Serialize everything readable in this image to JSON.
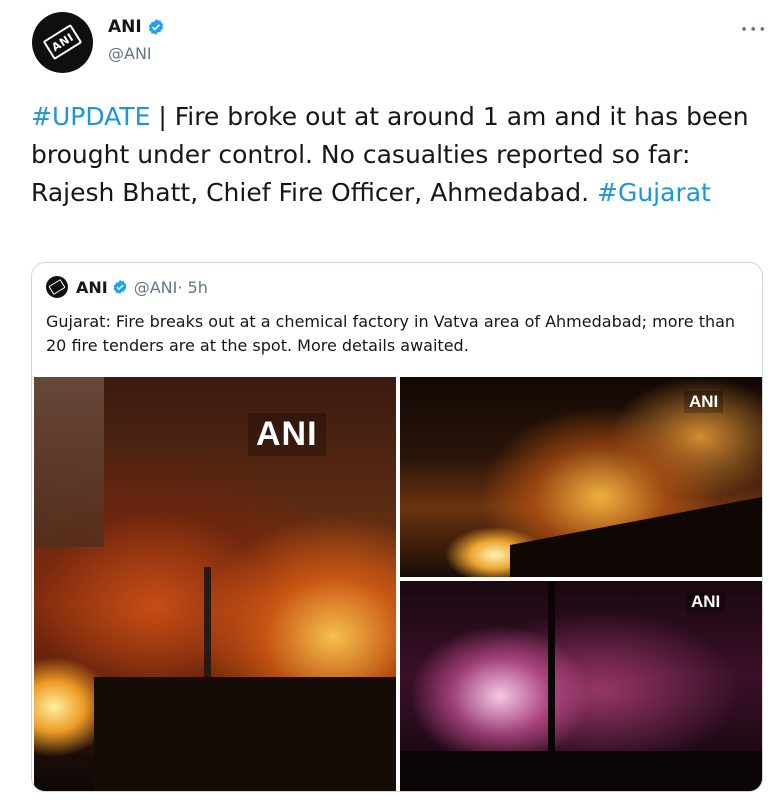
{
  "tweet": {
    "author_name": "ANI",
    "author_handle": "@ANI",
    "avatar_logo_text": "ANI",
    "more_glyph": "∙∙∙",
    "text_hashtag_1": "#UPDATE",
    "text_body": " |  Fire broke out at around 1 am and it has been brought under control. No casualties reported so far: Rajesh Bhatt, Chief Fire Officer, Ahmedabad. ",
    "text_hashtag_2": "#Gujarat"
  },
  "quoted": {
    "author_name": "ANI",
    "author_handle": "@ANI",
    "age": " · 5h",
    "text": "Gujarat: Fire breaks out at a chemical factory in Vatva area of Ahmedabad; more than 20 fire tenders are at the spot. More details awaited.",
    "photos": [
      {
        "watermark": "ANI"
      },
      {
        "watermark": "ANI"
      },
      {
        "watermark": "ANI"
      }
    ]
  },
  "colors": {
    "link": "#1b95e0",
    "verified": "#1da1f2",
    "secondary_text": "#657786",
    "border": "#ccd6dd"
  },
  "icons": {
    "verified": "verified-badge-icon",
    "more": "more-options-icon"
  }
}
